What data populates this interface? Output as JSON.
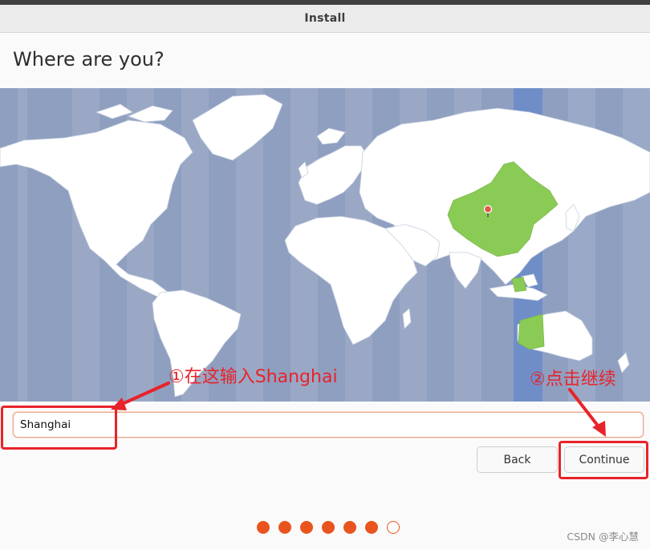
{
  "window": {
    "title": "Install"
  },
  "page": {
    "title": "Where are you?"
  },
  "map": {
    "selected_city_icon": "map-pin-icon",
    "colors": {
      "ocean": "#8f9fc0",
      "land": "#ffffff",
      "highlight_region": "#8acb55",
      "highlight_band": "#6f8ec8"
    }
  },
  "location": {
    "value": "Shanghai",
    "placeholder": ""
  },
  "buttons": {
    "back": "Back",
    "continue": "Continue"
  },
  "annotations": {
    "step1": "①在这输入Shanghai",
    "step2": "②点击继续",
    "color": "#e8232a"
  },
  "progress": {
    "total": 7,
    "completed": 6,
    "color": "#e9541e"
  },
  "watermark": "CSDN @李心慧"
}
